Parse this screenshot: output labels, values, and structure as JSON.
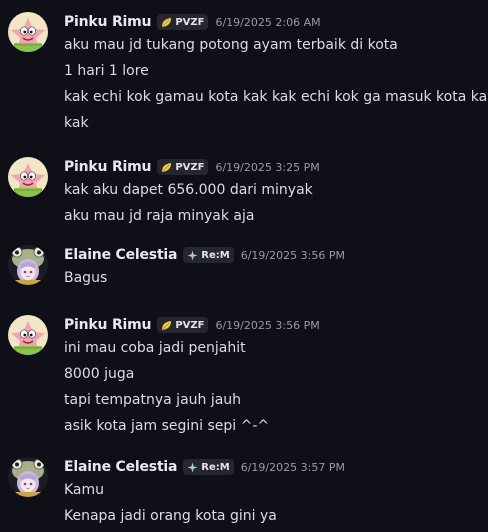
{
  "messages": [
    {
      "username": "Pinku Rimu",
      "avatar_icon": "patrick-star-avatar-icon",
      "tag_icon": "leaf-icon",
      "tag": "PVZF",
      "timestamp": "6/19/2025 2:06 AM",
      "lines": [
        "aku mau jd tukang potong ayam terbaik di kota",
        "1 hari 1 lore",
        "kak echi kok gamau kota kak kak echi kok ga masuk kota kak?",
        "kak"
      ]
    },
    {
      "username": "Pinku Rimu",
      "avatar_icon": "patrick-star-avatar-icon",
      "tag_icon": "leaf-icon",
      "tag": "PVZF",
      "timestamp": "6/19/2025 3:25 PM",
      "lines": [
        "kak aku dapet 656.000 dari minyak",
        "aku mau jd raja minyak aja"
      ]
    },
    {
      "username": "Elaine Celestia",
      "avatar_icon": "frog-hat-girl-avatar-icon",
      "tag_icon": "sparkle-icon",
      "tag": "Re:M",
      "timestamp": "6/19/2025 3:56 PM",
      "lines": [
        "Bagus"
      ]
    },
    {
      "username": "Pinku Rimu",
      "avatar_icon": "patrick-star-avatar-icon",
      "tag_icon": "leaf-icon",
      "tag": "PVZF",
      "timestamp": "6/19/2025 3:56 PM",
      "lines": [
        "ini mau coba jadi penjahit",
        "8000 juga",
        "tapi tempatnya jauh jauh",
        "asik kota jam segini sepi ^-^"
      ]
    },
    {
      "username": "Elaine Celestia",
      "avatar_icon": "frog-hat-girl-avatar-icon",
      "tag_icon": "sparkle-icon",
      "tag": "Re:M",
      "timestamp": "6/19/2025 3:57 PM",
      "lines": [
        "Kamu",
        "Kenapa jadi orang kota gini ya"
      ]
    }
  ],
  "colors": {
    "background": "#0f0f18",
    "username": "#e8e8ee",
    "text": "#dbdee1",
    "timestamp": "#9a9aa6",
    "tag_bg": "#26262f"
  }
}
